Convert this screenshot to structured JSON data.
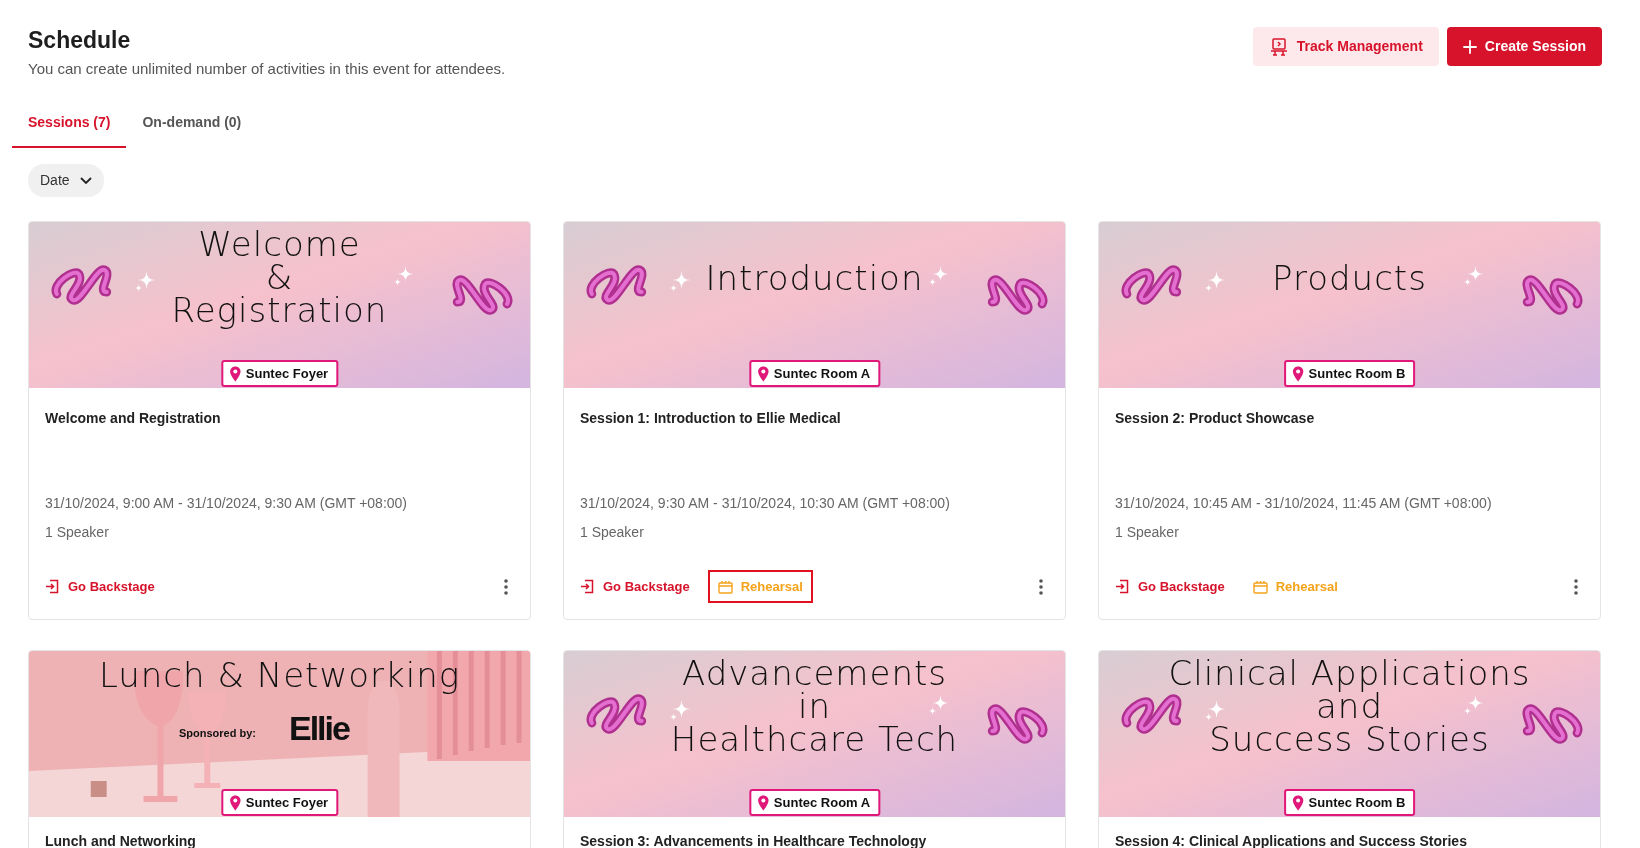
{
  "header": {
    "title": "Schedule",
    "subtitle": "You can create unlimited number of activities in this event for attendees."
  },
  "buttons": [
    {
      "label": "Track Management",
      "kind": "secondary"
    },
    {
      "label": "Create Session",
      "kind": "primary"
    }
  ],
  "tabs": [
    {
      "label": "Sessions (7)",
      "selected": true
    },
    {
      "label": "On-demand (0)",
      "selected": false
    }
  ],
  "filter": {
    "label": "Date"
  },
  "cards": [
    {
      "banner": {
        "kind": "squiggle",
        "title_lines": [
          "Welcome",
          "&",
          "Registration"
        ],
        "location": "Suntec Foyer"
      },
      "title": "Welcome and Registration",
      "datetime": "31/10/2024, 9:00 AM - 31/10/2024, 9:30 AM (GMT +08:00)",
      "speakers": "1 Speaker",
      "actions": [
        {
          "kind": "backstage",
          "label": "Go Backstage",
          "highlighted": false
        }
      ]
    },
    {
      "banner": {
        "kind": "squiggle",
        "title_lines": [
          "Introduction"
        ],
        "location": "Suntec Room A"
      },
      "title": "Session 1: Introduction to Ellie Medical",
      "datetime": "31/10/2024, 9:30 AM - 31/10/2024, 10:30 AM (GMT +08:00)",
      "speakers": "1 Speaker",
      "actions": [
        {
          "kind": "backstage",
          "label": "Go Backstage",
          "highlighted": false
        },
        {
          "kind": "rehearsal",
          "label": "Rehearsal",
          "highlighted": true
        }
      ]
    },
    {
      "banner": {
        "kind": "squiggle",
        "title_lines": [
          "Products"
        ],
        "location": "Suntec Room B"
      },
      "title": "Session 2: Product Showcase",
      "datetime": "31/10/2024, 10:45 AM - 31/10/2024, 11:45 AM (GMT +08:00)",
      "speakers": "1 Speaker",
      "actions": [
        {
          "kind": "backstage",
          "label": "Go Backstage",
          "highlighted": false
        },
        {
          "kind": "rehearsal",
          "label": "Rehearsal",
          "highlighted": false
        }
      ]
    },
    {
      "banner": {
        "kind": "room",
        "title_lines": [
          "Lunch & Networking"
        ],
        "sponsor_label": "Sponsored by:",
        "sponsor_name": "Ellie",
        "location": "Suntec Foyer"
      },
      "title": "Lunch and Networking"
    },
    {
      "banner": {
        "kind": "squiggle",
        "title_lines": [
          "Advancements",
          "in",
          "Healthcare Tech"
        ],
        "location": "Suntec Room A"
      },
      "title": "Session 3: Advancements in Healthcare Technology"
    },
    {
      "banner": {
        "kind": "squiggle",
        "title_lines": [
          "Clinical Applications",
          "and",
          "Success Stories"
        ],
        "location": "Suntec Room B"
      },
      "title": "Session 4: Clinical Applications and Success Stories"
    }
  ]
}
